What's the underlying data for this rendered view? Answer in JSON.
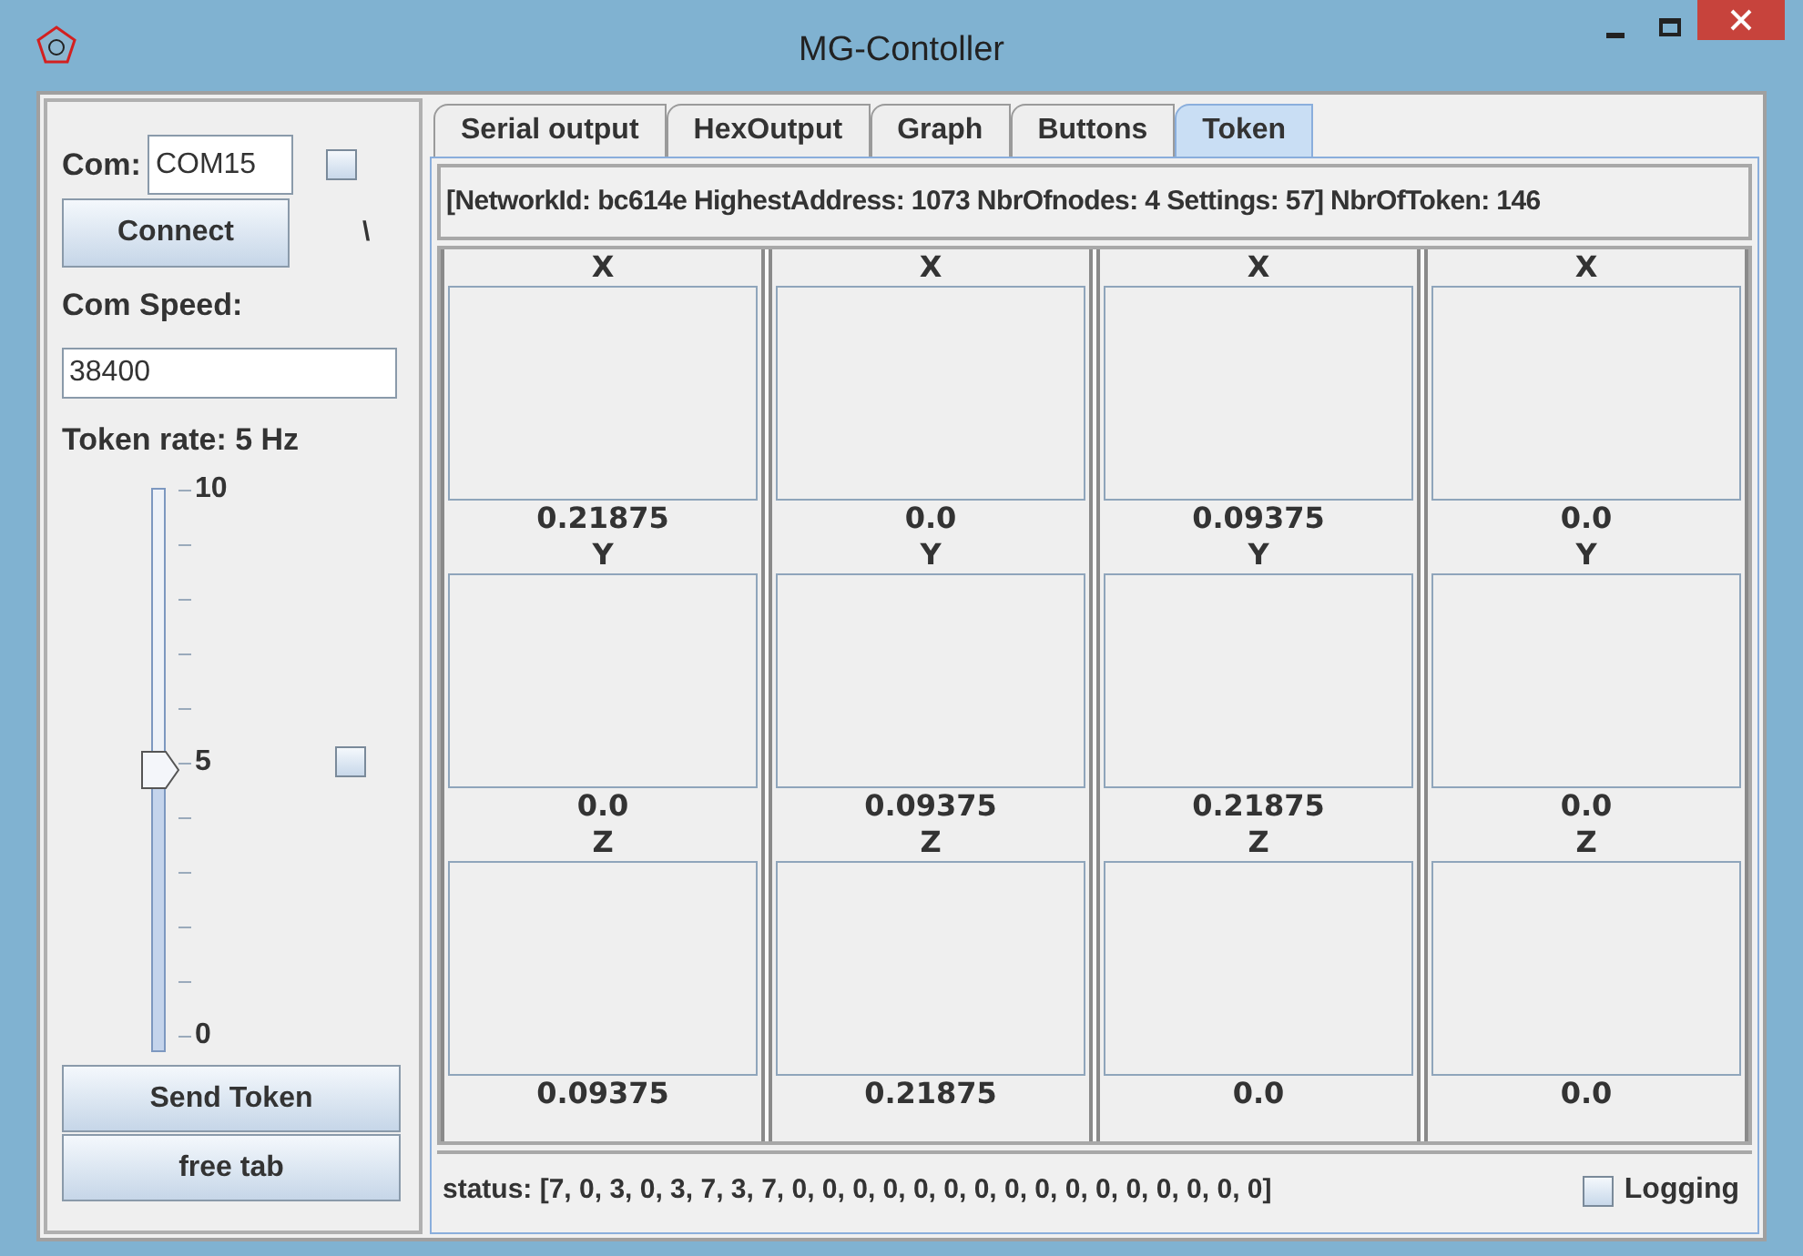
{
  "window": {
    "title": "MG-Contoller"
  },
  "left_panel": {
    "com_label": "Com:",
    "com_value": "COM15",
    "com_checkbox": {
      "checked": false
    },
    "connect_button": "Connect",
    "busy_indicator": "\\",
    "speed_label": "Com Speed:",
    "speed_value": "38400",
    "rate_label": "Token rate: 5 Hz",
    "slider": {
      "level": 0.5,
      "labels": [
        "10",
        "5",
        "0"
      ]
    },
    "slider_checkbox": {
      "checked": false
    },
    "buttons": [
      "Send Token",
      "free tab"
    ]
  },
  "tabs": [
    {
      "label": "Serial output",
      "selected": false
    },
    {
      "label": "HexOutput",
      "selected": false
    },
    {
      "label": "Graph",
      "selected": false
    },
    {
      "label": "Buttons",
      "selected": false
    },
    {
      "label": "Token",
      "selected": true
    }
  ],
  "info": "[NetworkId: bc614e HighestAddress: 1073 NbrOfnodes: 4 Settings: 57] NbrOfToken: 146",
  "columns": [
    {
      "axes": [
        {
          "label": "X",
          "reading": "0.21875"
        },
        {
          "label": "Y",
          "reading": "0.0"
        },
        {
          "label": "Z",
          "reading": "0.09375"
        }
      ]
    },
    {
      "axes": [
        {
          "label": "X",
          "reading": "0.0"
        },
        {
          "label": "Y",
          "reading": "0.09375"
        },
        {
          "label": "Z",
          "reading": "0.21875"
        }
      ]
    },
    {
      "axes": [
        {
          "label": "X",
          "reading": "0.09375"
        },
        {
          "label": "Y",
          "reading": "0.21875"
        },
        {
          "label": "Z",
          "reading": "0.0"
        }
      ]
    },
    {
      "axes": [
        {
          "label": "X",
          "reading": "0.0"
        },
        {
          "label": "Y",
          "reading": "0.0"
        },
        {
          "label": "Z",
          "reading": "0.0"
        }
      ]
    }
  ],
  "status": "status: [7, 0, 3, 0, 3, 7, 3, 7, 0, 0, 0, 0, 0, 0, 0, 0, 0, 0, 0, 0, 0, 0, 0, 0]",
  "logging": {
    "label": "Logging",
    "checked": false
  }
}
